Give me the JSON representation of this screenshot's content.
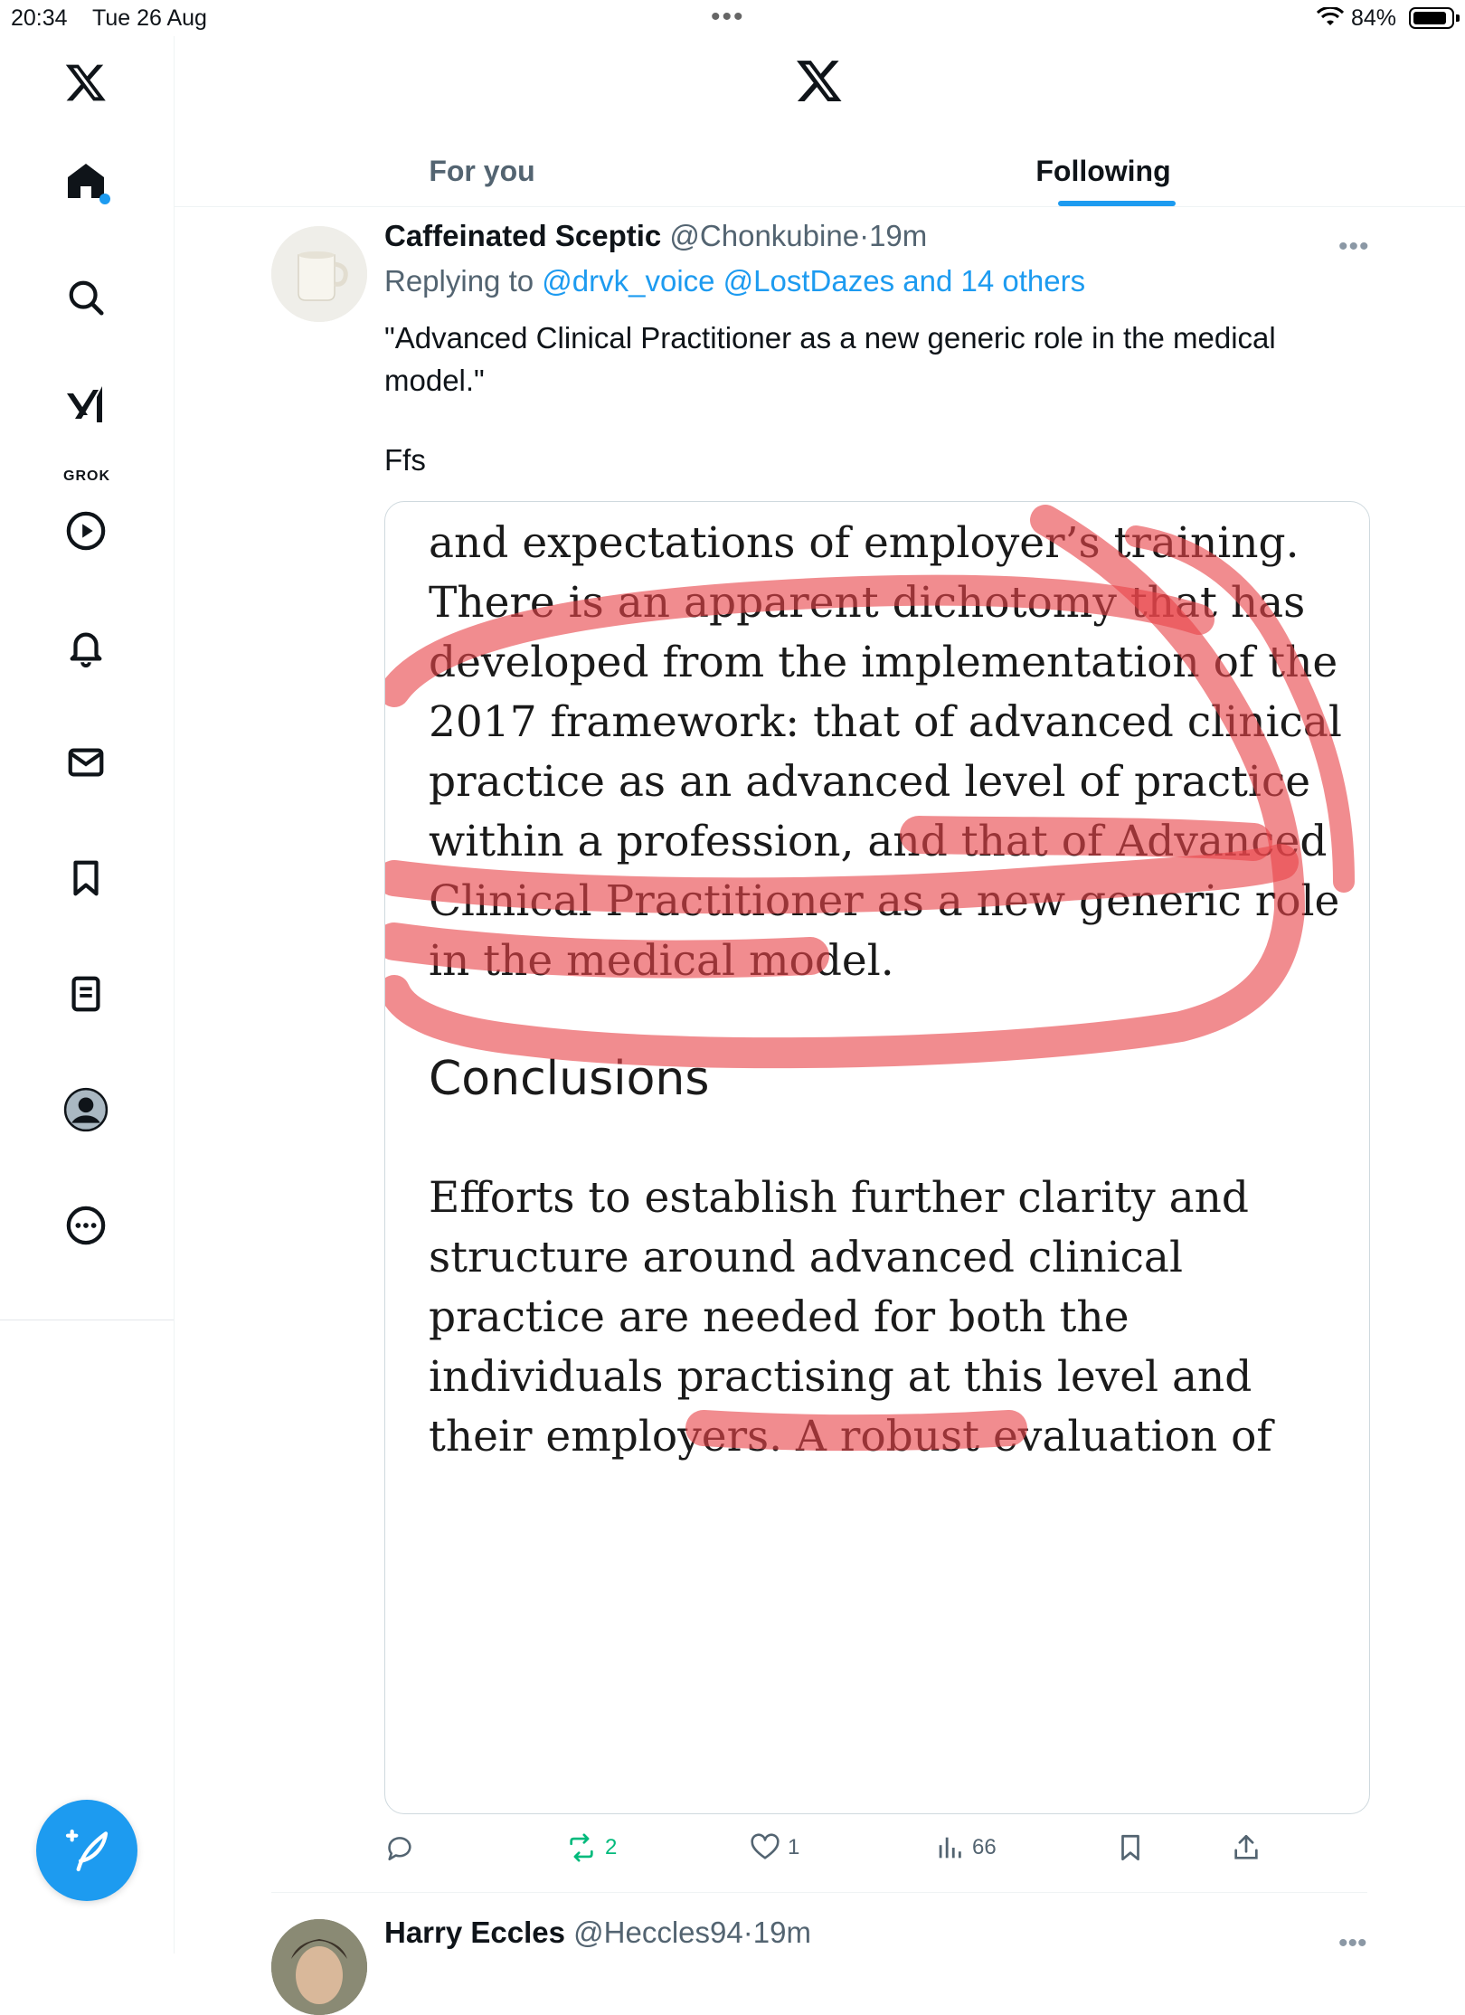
{
  "status_bar": {
    "time": "20:34",
    "date": "Tue 26 Aug",
    "battery": "84%"
  },
  "sidebar": {
    "items": [
      {
        "name": "home",
        "icon": "home-icon"
      },
      {
        "name": "explore",
        "icon": "search-icon"
      },
      {
        "name": "grok",
        "icon": "grok-icon",
        "label": "GROK"
      },
      {
        "name": "videos",
        "icon": "play-icon"
      },
      {
        "name": "notifications",
        "icon": "bell-icon"
      },
      {
        "name": "messages",
        "icon": "mail-icon"
      },
      {
        "name": "bookmarks",
        "icon": "bookmark-icon"
      },
      {
        "name": "lists",
        "icon": "list-icon"
      },
      {
        "name": "profile",
        "icon": "profile-icon"
      },
      {
        "name": "more",
        "icon": "more-icon"
      }
    ],
    "compose_icon": "compose-icon"
  },
  "tabs": [
    {
      "label": "For you",
      "active": false
    },
    {
      "label": "Following",
      "active": true
    }
  ],
  "tweet": {
    "display_name": "Caffeinated Sceptic",
    "handle": "@Chonkubine",
    "sep": "·",
    "time": "19m",
    "replying_prefix": "Replying to",
    "replying_to": "@drvk_voice @LostDazes and 14 others",
    "text": "\"Advanced Clinical Practitioner as a new generic role in the medical model.\"",
    "text2": "Ffs",
    "image_lines": [
      "and expectations of employer’s training.",
      "There is an apparent dichotomy that has",
      "developed from the implementation of the",
      "2017 framework: that of advanced clinical",
      "practice as an advanced level of practice",
      "within a profession, and that of Advanced",
      "Clinical Practitioner as a new generic role",
      "in the medical model."
    ],
    "image_heading": "Conclusions",
    "image_lines2": [
      "Efforts to establish further clarity and",
      "structure around advanced clinical",
      "practice are needed for both the",
      "individuals practising at this level and",
      "their employers. A robust evaluation of"
    ],
    "highlight_color": "#e8454a",
    "stats": {
      "replies": "",
      "retweets": "2",
      "likes": "1",
      "views": "66"
    }
  },
  "next_tweet": {
    "display_name": "Harry Eccles",
    "handle": "@Heccles94",
    "sep": "·",
    "time": "19m"
  },
  "colors": {
    "accent": "#1d9bf0",
    "retweet": "#00ba7c",
    "muted": "#536471"
  }
}
